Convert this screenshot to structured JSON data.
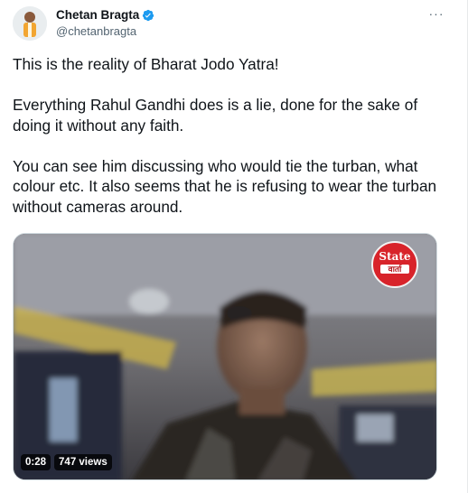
{
  "author": {
    "name": "Chetan Bragta",
    "handle": "@chetanbragta",
    "verified": true
  },
  "more_label": "···",
  "tweet": {
    "paragraphs": [
      "This is the reality of Bharat Jodo Yatra!",
      "Everything Rahul Gandhi does is a lie, done for the sake of doing it without any faith.",
      "You can see him discussing who would tie the turban, what colour etc. It also seems that he is refusing to wear the turban without cameras around."
    ]
  },
  "media": {
    "type": "video",
    "duration": "0:28",
    "views": "747 views",
    "logo_text_top": "State",
    "logo_text_bottom": "वार्ता"
  },
  "colors": {
    "verified": "#1d9bf0",
    "logo_red": "#d8232a",
    "secondary_text": "#536471"
  }
}
